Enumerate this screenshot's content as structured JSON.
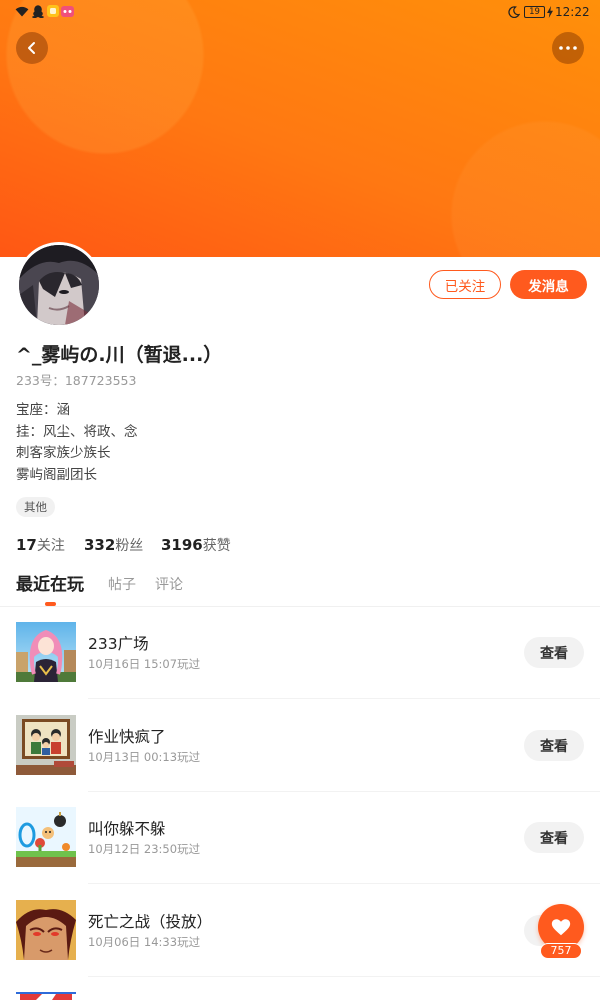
{
  "theme": {
    "accent": "#FF5A1E",
    "header_top": "#FF900A",
    "header_bottom": "#FF5714"
  },
  "status_bar": {
    "time": "12:22",
    "battery": "19",
    "left_icons": [
      "wifi-icon",
      "qq-icon",
      "app-notification-icon",
      "app-notification-icon"
    ],
    "right_icons": [
      "moon-icon",
      "battery-icon",
      "charging-icon"
    ]
  },
  "nav": {
    "back_icon": "back-icon",
    "more_icon": "more-icon"
  },
  "profile": {
    "name": "^_雾屿の.川（暂退...）",
    "id_line": "233号：187723553",
    "bio": [
      "宝座：涵",
      "挂：风尘、将政、念",
      "刺客家族少族长",
      "雾屿阁副团长"
    ],
    "tag": "其他"
  },
  "actions": {
    "followed": "已关注",
    "message": "发消息"
  },
  "stats": [
    {
      "count": "17",
      "label": "关注"
    },
    {
      "count": "332",
      "label": "粉丝"
    },
    {
      "count": "3196",
      "label": "获赞"
    }
  ],
  "tabs": [
    {
      "label": "最近在玩",
      "active": true
    },
    {
      "label": "帖子",
      "active": false
    },
    {
      "label": "评论",
      "active": false
    }
  ],
  "games": [
    {
      "title": "233广场",
      "played": "10月16日 15:07玩过",
      "action": "查看"
    },
    {
      "title": "作业快疯了",
      "played": "10月13日 00:13玩过",
      "action": "查看"
    },
    {
      "title": "叫你躲不躲",
      "played": "10月12日 23:50玩过",
      "action": "查看"
    },
    {
      "title": "死亡之战（投放）",
      "played": "10月06日 14:33玩过"
    }
  ],
  "like": {
    "count": "757",
    "icon": "heart-icon"
  }
}
